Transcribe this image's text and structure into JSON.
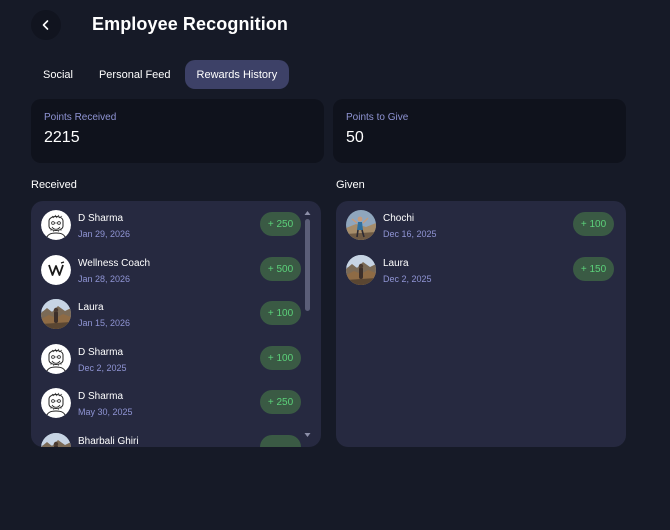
{
  "header": {
    "title": "Employee Recognition"
  },
  "tabs": [
    {
      "label": "Social",
      "active": false
    },
    {
      "label": "Personal Feed",
      "active": false
    },
    {
      "label": "Rewards History",
      "active": true
    }
  ],
  "stats": {
    "received": {
      "label": "Points Received",
      "value": "2215"
    },
    "to_give": {
      "label": "Points to Give",
      "value": "50"
    }
  },
  "received": {
    "title": "Received",
    "items": [
      {
        "name": "D Sharma",
        "date": "Jan 29, 2026",
        "points": "+ 250",
        "avatar": "sketch-portrait-icon"
      },
      {
        "name": "Wellness Coach",
        "date": "Jan 28, 2026",
        "points": "+ 500",
        "avatar": "w-logo-icon"
      },
      {
        "name": "Laura",
        "date": "Jan 15, 2026",
        "points": "+ 100",
        "avatar": "landscape-photo-icon"
      },
      {
        "name": "D Sharma",
        "date": "Dec 2, 2025",
        "points": "+ 100",
        "avatar": "sketch-portrait-icon"
      },
      {
        "name": "D Sharma",
        "date": "May 30, 2025",
        "points": "+ 250",
        "avatar": "sketch-portrait-icon"
      },
      {
        "name": "Bharbali Ghiri",
        "date": "",
        "points": "",
        "avatar": "landscape-photo-icon"
      }
    ]
  },
  "given": {
    "title": "Given",
    "items": [
      {
        "name": "Chochi",
        "date": "Dec 16, 2025",
        "points": "+ 100",
        "avatar": "person-photo-icon"
      },
      {
        "name": "Laura",
        "date": "Dec 2, 2025",
        "points": "+ 150",
        "avatar": "landscape-photo-icon"
      }
    ]
  },
  "colors": {
    "background": "#161a27",
    "card": "#0f121c",
    "panel": "#262940",
    "active_tab": "#3d4167",
    "accent_text": "#8f94d4",
    "points_pill": "#3a5a44",
    "points_text": "#5cd17a"
  }
}
